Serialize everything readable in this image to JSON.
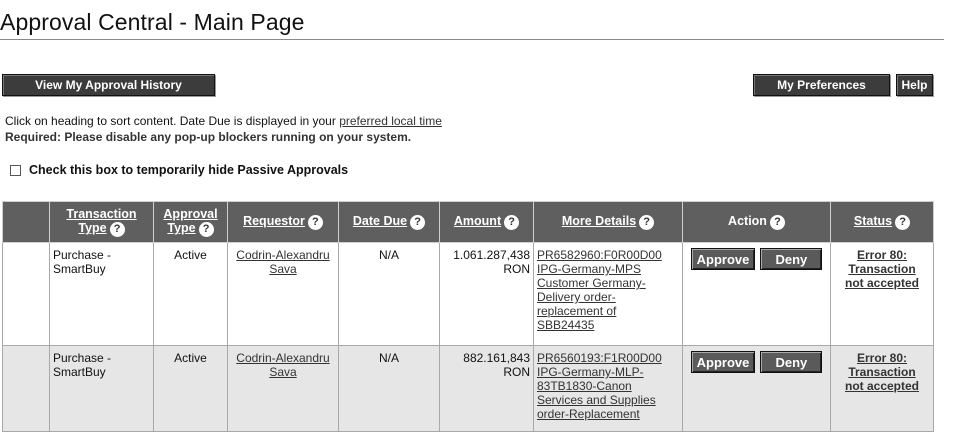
{
  "page": {
    "title": "Approval Central - Main Page"
  },
  "toolbar": {
    "history_label": "View My Approval History",
    "preferences_label": "My Preferences",
    "help_label": "Help"
  },
  "info": {
    "line1_prefix": "Click on heading to sort content. Date Due is displayed in your ",
    "line1_link": "preferred local time",
    "line2": "Required: Please disable any pop-up blockers running on your system."
  },
  "passive_checkbox": {
    "label": "Check this box to temporarily hide Passive Approvals",
    "checked": false
  },
  "table": {
    "headers": {
      "transaction_type": [
        "Transaction",
        "Type"
      ],
      "approval_type": [
        "Approval",
        "Type"
      ],
      "requestor": "Requestor",
      "date_due": "Date Due",
      "amount": "Amount",
      "more_details": "More Details",
      "action": "Action",
      "status": "Status"
    },
    "help_icon": "question-circle-icon",
    "rows": [
      {
        "transaction_type": [
          "Purchase -",
          "SmartBuy"
        ],
        "approval_type": "Active",
        "requestor": [
          "Codrin-Alexandru",
          "Sava"
        ],
        "date_due": "N/A",
        "amount": [
          "1.061.287,438",
          "RON"
        ],
        "details": [
          "PR6582960:F0R00D00",
          "IPG-Germany-MPS",
          "Customer Germany-",
          "Delivery order-",
          "replacement of",
          "SBB24435"
        ],
        "approve_label": "Approve",
        "deny_label": "Deny",
        "status": [
          "Error 80:",
          "Transaction",
          "not accepted"
        ]
      },
      {
        "transaction_type": [
          "Purchase -",
          "SmartBuy"
        ],
        "approval_type": "Active",
        "requestor": [
          "Codrin-Alexandru",
          "Sava"
        ],
        "date_due": "N/A",
        "amount": [
          "882.161,843",
          "RON"
        ],
        "details": [
          "PR6560193:F1R00D00",
          "IPG-Germany-MLP-",
          "83TB1830-Canon",
          "Services and Supplies",
          "order-Replacement"
        ],
        "approve_label": "Approve",
        "deny_label": "Deny",
        "status": [
          "Error 80:",
          "Transaction",
          "not accepted"
        ]
      }
    ]
  }
}
